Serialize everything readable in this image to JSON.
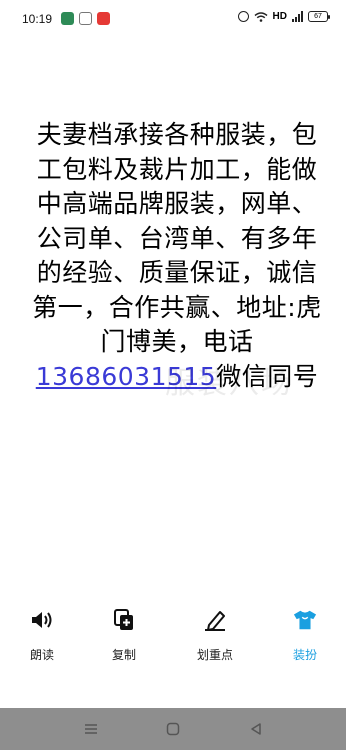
{
  "status_bar": {
    "time": "10:19",
    "hd_label": "HD",
    "battery": "67",
    "icons": [
      "app-green-icon",
      "app-blue-icon",
      "app-red-icon",
      "alarm-icon",
      "wifi-icon",
      "signal-icon",
      "battery-icon"
    ]
  },
  "content": {
    "text_before_phone": "夫妻档承接各种服装，包工包料及裁片加工，能做中高端品牌服装，网单、公司单、台湾单、有多年的经验、质量保证，诚信第一，合作共赢、地址:虎门博美，电话",
    "phone": "13686031515",
    "text_after_phone": "微信同号",
    "link_color": "#3a3ad6"
  },
  "watermark": {
    "text": "服装八场"
  },
  "toolbar": {
    "items": [
      {
        "label": "朗读",
        "icon": "speaker-icon"
      },
      {
        "label": "复制",
        "icon": "copy-icon"
      },
      {
        "label": "划重点",
        "icon": "highlight-pen-icon"
      },
      {
        "label": "装扮",
        "icon": "tshirt-icon",
        "active": true,
        "color": "#1a9fe0"
      }
    ]
  },
  "navbar": {
    "buttons": [
      "menu-icon",
      "home-icon",
      "back-icon"
    ],
    "background": "#8e8e8e"
  }
}
